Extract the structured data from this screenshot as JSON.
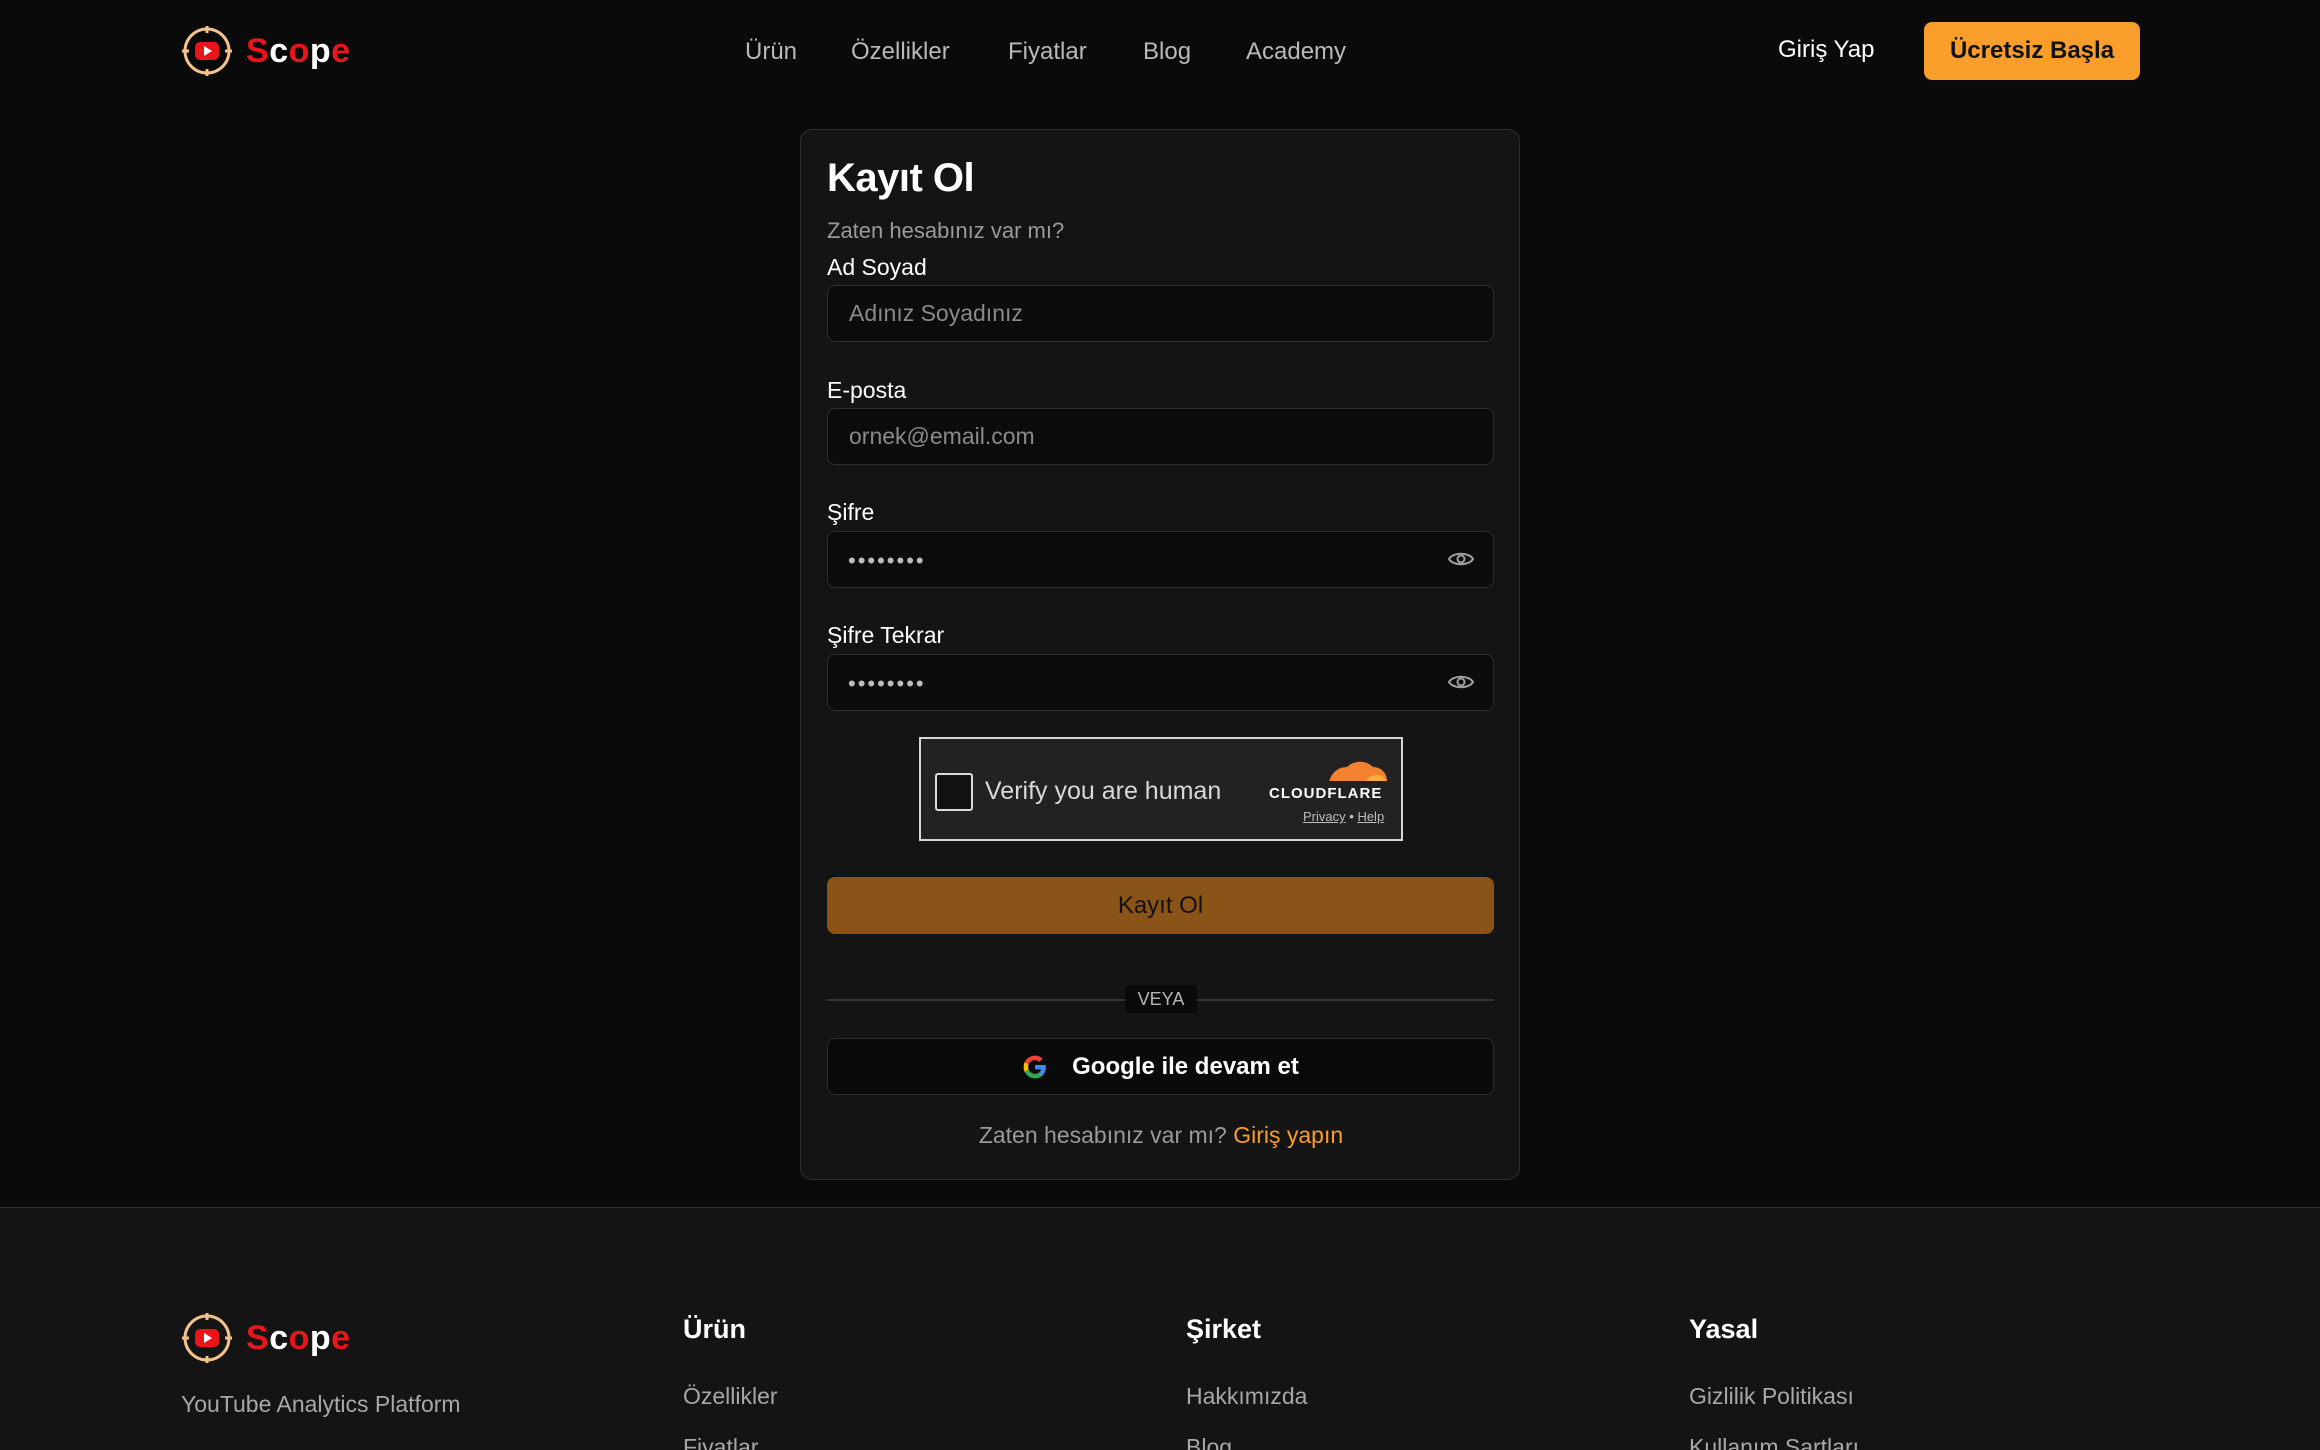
{
  "header": {
    "brand": {
      "part1": "S",
      "part2": "c",
      "part3": "o",
      "part4": "p",
      "part5": "e"
    },
    "nav": [
      "Ürün",
      "Özellikler",
      "Fiyatlar",
      "Blog",
      "Academy"
    ],
    "login_label": "Giriş Yap",
    "cta_label": "Ücretsiz Başla"
  },
  "signup": {
    "title": "Kayıt Ol",
    "subtitle": "Zaten hesabınız var mı?",
    "name_label": "Ad Soyad",
    "name_placeholder": "Adınız Soyadınız",
    "email_label": "E-posta",
    "email_placeholder": "ornek@email.com",
    "password_label": "Şifre",
    "password_mask": "••••••••",
    "password_confirm_label": "Şifre Tekrar",
    "password_confirm_mask": "••••••••",
    "captcha": {
      "text": "Verify you are human",
      "provider": "CLOUDFLARE",
      "privacy": "Privacy",
      "separator": "•",
      "help": "Help"
    },
    "submit_label": "Kayıt Ol",
    "divider_text": "VEYA",
    "google_label": "Google ile devam et",
    "login_prompt": "Zaten hesabınız var mı?",
    "login_link": "Giriş yapın"
  },
  "footer": {
    "tagline": "YouTube Analytics Platform",
    "columns": [
      {
        "title": "Ürün",
        "links": [
          "Özellikler",
          "Fiyatlar"
        ]
      },
      {
        "title": "Şirket",
        "links": [
          "Hakkımızda",
          "Blog"
        ]
      },
      {
        "title": "Yasal",
        "links": [
          "Gizlilik Politikası",
          "Kullanım Şartları"
        ]
      }
    ]
  },
  "colors": {
    "background": "#0a0a0a",
    "card": "#141414",
    "accent": "#f99d2b",
    "submit": "#8a5419",
    "brand_red": "#e8151b"
  },
  "icons": {
    "logo": "scope-logo-icon",
    "eye": "eye-icon",
    "google": "google-icon",
    "cloudflare": "cloudflare-logo-icon"
  }
}
